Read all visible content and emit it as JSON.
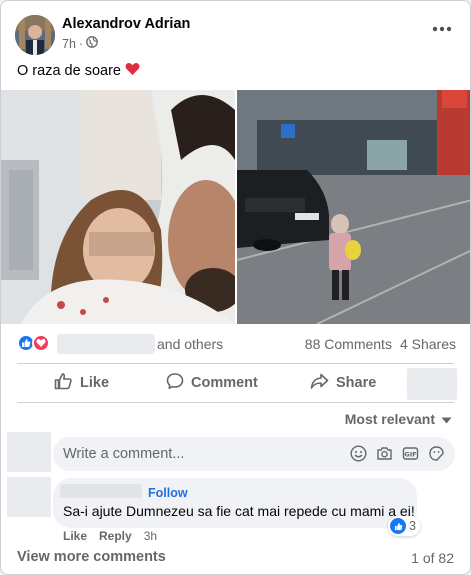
{
  "post": {
    "author": "Alexandrov Adrian",
    "time": "7h",
    "dot": "·",
    "text": "O raza de soare",
    "more_label": "•••"
  },
  "reactions": {
    "others_label": "and others",
    "comments": "88 Comments",
    "shares": "4 Shares",
    "icons": [
      "like-reaction-icon",
      "love-reaction-icon"
    ]
  },
  "actions": {
    "like": "Like",
    "comment": "Comment",
    "share": "Share"
  },
  "comments_section": {
    "sort_label": "Most relevant",
    "input_placeholder": "Write a comment...",
    "input_icons": [
      "emoji-icon",
      "camera-icon",
      "gif-icon",
      "sticker-icon"
    ],
    "comment": {
      "follow_label": "Follow",
      "text": "Sa-i ajute Dumnezeu sa fie cat mai repede cu mami a ei!",
      "reaction_count": "3",
      "like_label": "Like",
      "reply_label": "Reply",
      "time": "3h"
    },
    "view_more": "View more comments",
    "pagination": "1 of 82"
  },
  "colors": {
    "accent_blue": "#1877f2",
    "love_red": "#f33e58",
    "secondary_text": "#65676b",
    "follow_blue": "#216fdb"
  }
}
